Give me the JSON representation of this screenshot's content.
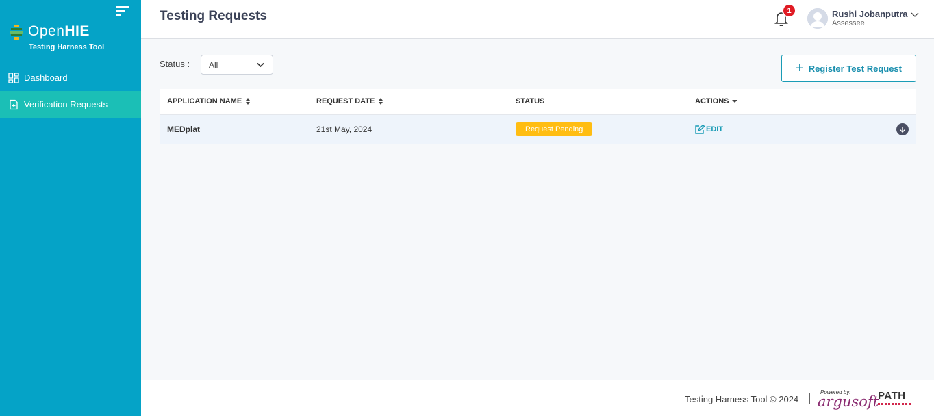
{
  "sidebar": {
    "logo": {
      "name_light": "Open",
      "name_bold": "HIE",
      "subtitle": "Testing Harness Tool"
    },
    "items": [
      {
        "label": "Dashboard",
        "icon": "dashboard-icon",
        "active": false
      },
      {
        "label": "Verification Requests",
        "icon": "document-icon",
        "active": true
      }
    ]
  },
  "header": {
    "title": "Testing Requests",
    "notifications": {
      "count": "1"
    },
    "user": {
      "name": "Rushi Jobanputra",
      "role": "Assessee"
    }
  },
  "filter": {
    "label": "Status :",
    "selected": "All"
  },
  "actions": {
    "register_label": "Register Test Request"
  },
  "table": {
    "columns": [
      {
        "label": "APPLICATION NAME",
        "sortable": true
      },
      {
        "label": "REQUEST DATE",
        "sortable": true
      },
      {
        "label": "STATUS",
        "sortable": false
      },
      {
        "label": "ACTIONS",
        "dropdown": true
      }
    ],
    "rows": [
      {
        "application_name": "MEDplat",
        "request_date": "21st May, 2024",
        "status": "Request Pending",
        "action": "EDIT"
      }
    ]
  },
  "footer": {
    "copyright": "Testing Harness Tool © 2024",
    "powered_by": "Powered by:",
    "argusoft": "argusoft",
    "path": "PATH"
  },
  "colors": {
    "sidebar": "#05a3c7",
    "active_nav": "#1bbfb6",
    "accent": "#1a9cb6",
    "pending": "#ffbd12",
    "badge": "#e01b24"
  }
}
